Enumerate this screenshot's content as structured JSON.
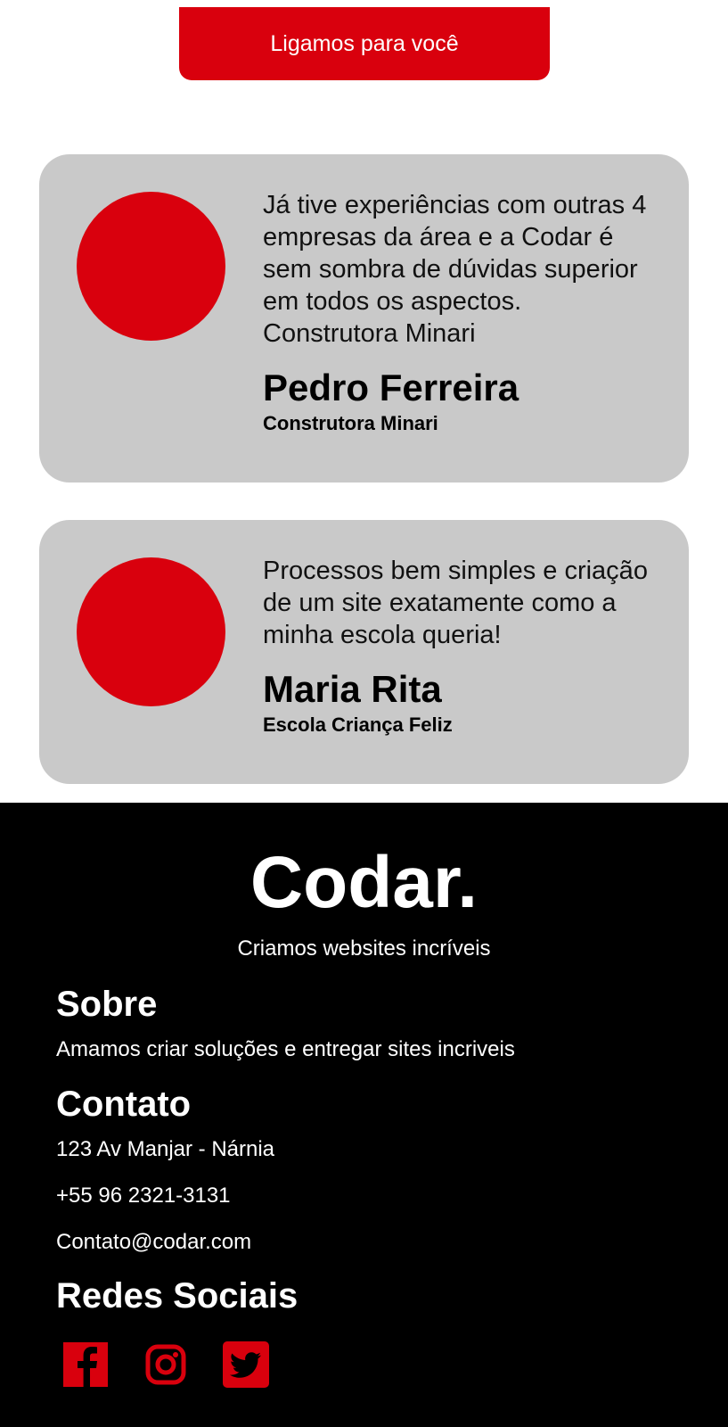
{
  "cta": {
    "label": "Ligamos para você"
  },
  "testimonials": [
    {
      "quote": "Já tive experiências com outras 4 empresas da área e a Codar é sem sombra de dúvidas superior em todos os aspectos. Construtora Minari",
      "author": "Pedro Ferreira",
      "company": "Construtora Minari"
    },
    {
      "quote": "Processos bem simples e criação de um site exatamente como a minha escola queria!",
      "author": "Maria Rita",
      "company": "Escola Criança Feliz"
    }
  ],
  "footer": {
    "logo": "Codar.",
    "tagline": "Criamos websites incríveis",
    "sobre": {
      "heading": "Sobre",
      "text": "Amamos criar soluções e entregar sites incriveis"
    },
    "contato": {
      "heading": "Contato",
      "address": "123 Av Manjar - Nárnia",
      "phone": "+55 96 2321-3131",
      "email": "Contato@codar.com"
    },
    "redes": {
      "heading": "Redes Sociais",
      "icons": [
        "facebook-icon",
        "instagram-icon",
        "twitter-icon"
      ]
    }
  },
  "colors": {
    "accent": "#d9000d",
    "card": "#c9c9c9",
    "footer_bg": "#000000"
  }
}
